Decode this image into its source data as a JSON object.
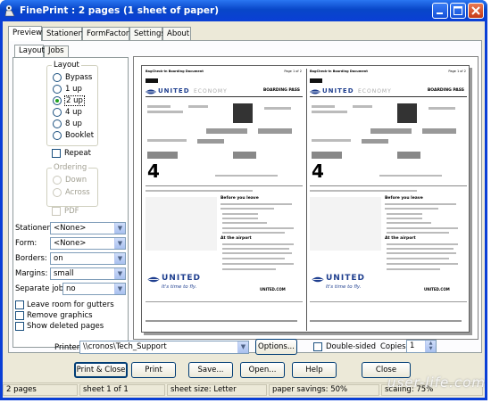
{
  "window": {
    "title": "FinePrint : 2 pages (1 sheet of paper)"
  },
  "tabs": {
    "main": [
      "Preview",
      "Stationery",
      "FormFactory",
      "Settings",
      "About"
    ],
    "side": [
      "Layout",
      "Jobs"
    ]
  },
  "layout": {
    "group_title": "Layout",
    "options": [
      "Bypass",
      "1 up",
      "2 up",
      "4 up",
      "8 up",
      "Booklet"
    ],
    "selected": "2 up",
    "repeat_label": "Repeat"
  },
  "ordering": {
    "group_title": "Ordering",
    "options": [
      "Down",
      "Across"
    ],
    "pdf_label": "PDF"
  },
  "fields": {
    "stationery_label": "Stationery:",
    "stationery_value": "<None>",
    "form_label": "Form:",
    "form_value": "<None>",
    "borders_label": "Borders:",
    "borders_value": "on",
    "margins_label": "Margins:",
    "margins_value": "small",
    "separate_label": "Separate jobs:",
    "separate_value": "no"
  },
  "checkboxes": [
    "Leave room for gutters",
    "Remove graphics",
    "Show deleted pages"
  ],
  "preview": {
    "doc_header_left": "BagCheck-in Boarding Document",
    "doc_header_right": "Page 1 of 2",
    "airline": "UNITED",
    "airline_sub": "ECONOMY",
    "pass_label": "BOARDING PASS",
    "group_number": "4",
    "tagline": "It's time to fly.",
    "site": "UNITED.COM",
    "before_title": "Before you leave",
    "airport_title": "At the airport"
  },
  "printer": {
    "label": "Printer:",
    "value": "\\\\cronos\\Tech_Support",
    "options_button": "Options...",
    "double_sided": "Double-sided",
    "copies_label": "Copies:",
    "copies_value": "1"
  },
  "buttons": [
    "Print & Close",
    "Print",
    "Save...",
    "Open...",
    "Help",
    "Close"
  ],
  "status": [
    "2 pages",
    "sheet 1 of 1",
    "sheet size: Letter",
    "paper savings: 50%",
    "scaling: 75%"
  ],
  "watermark": "user-life.com"
}
